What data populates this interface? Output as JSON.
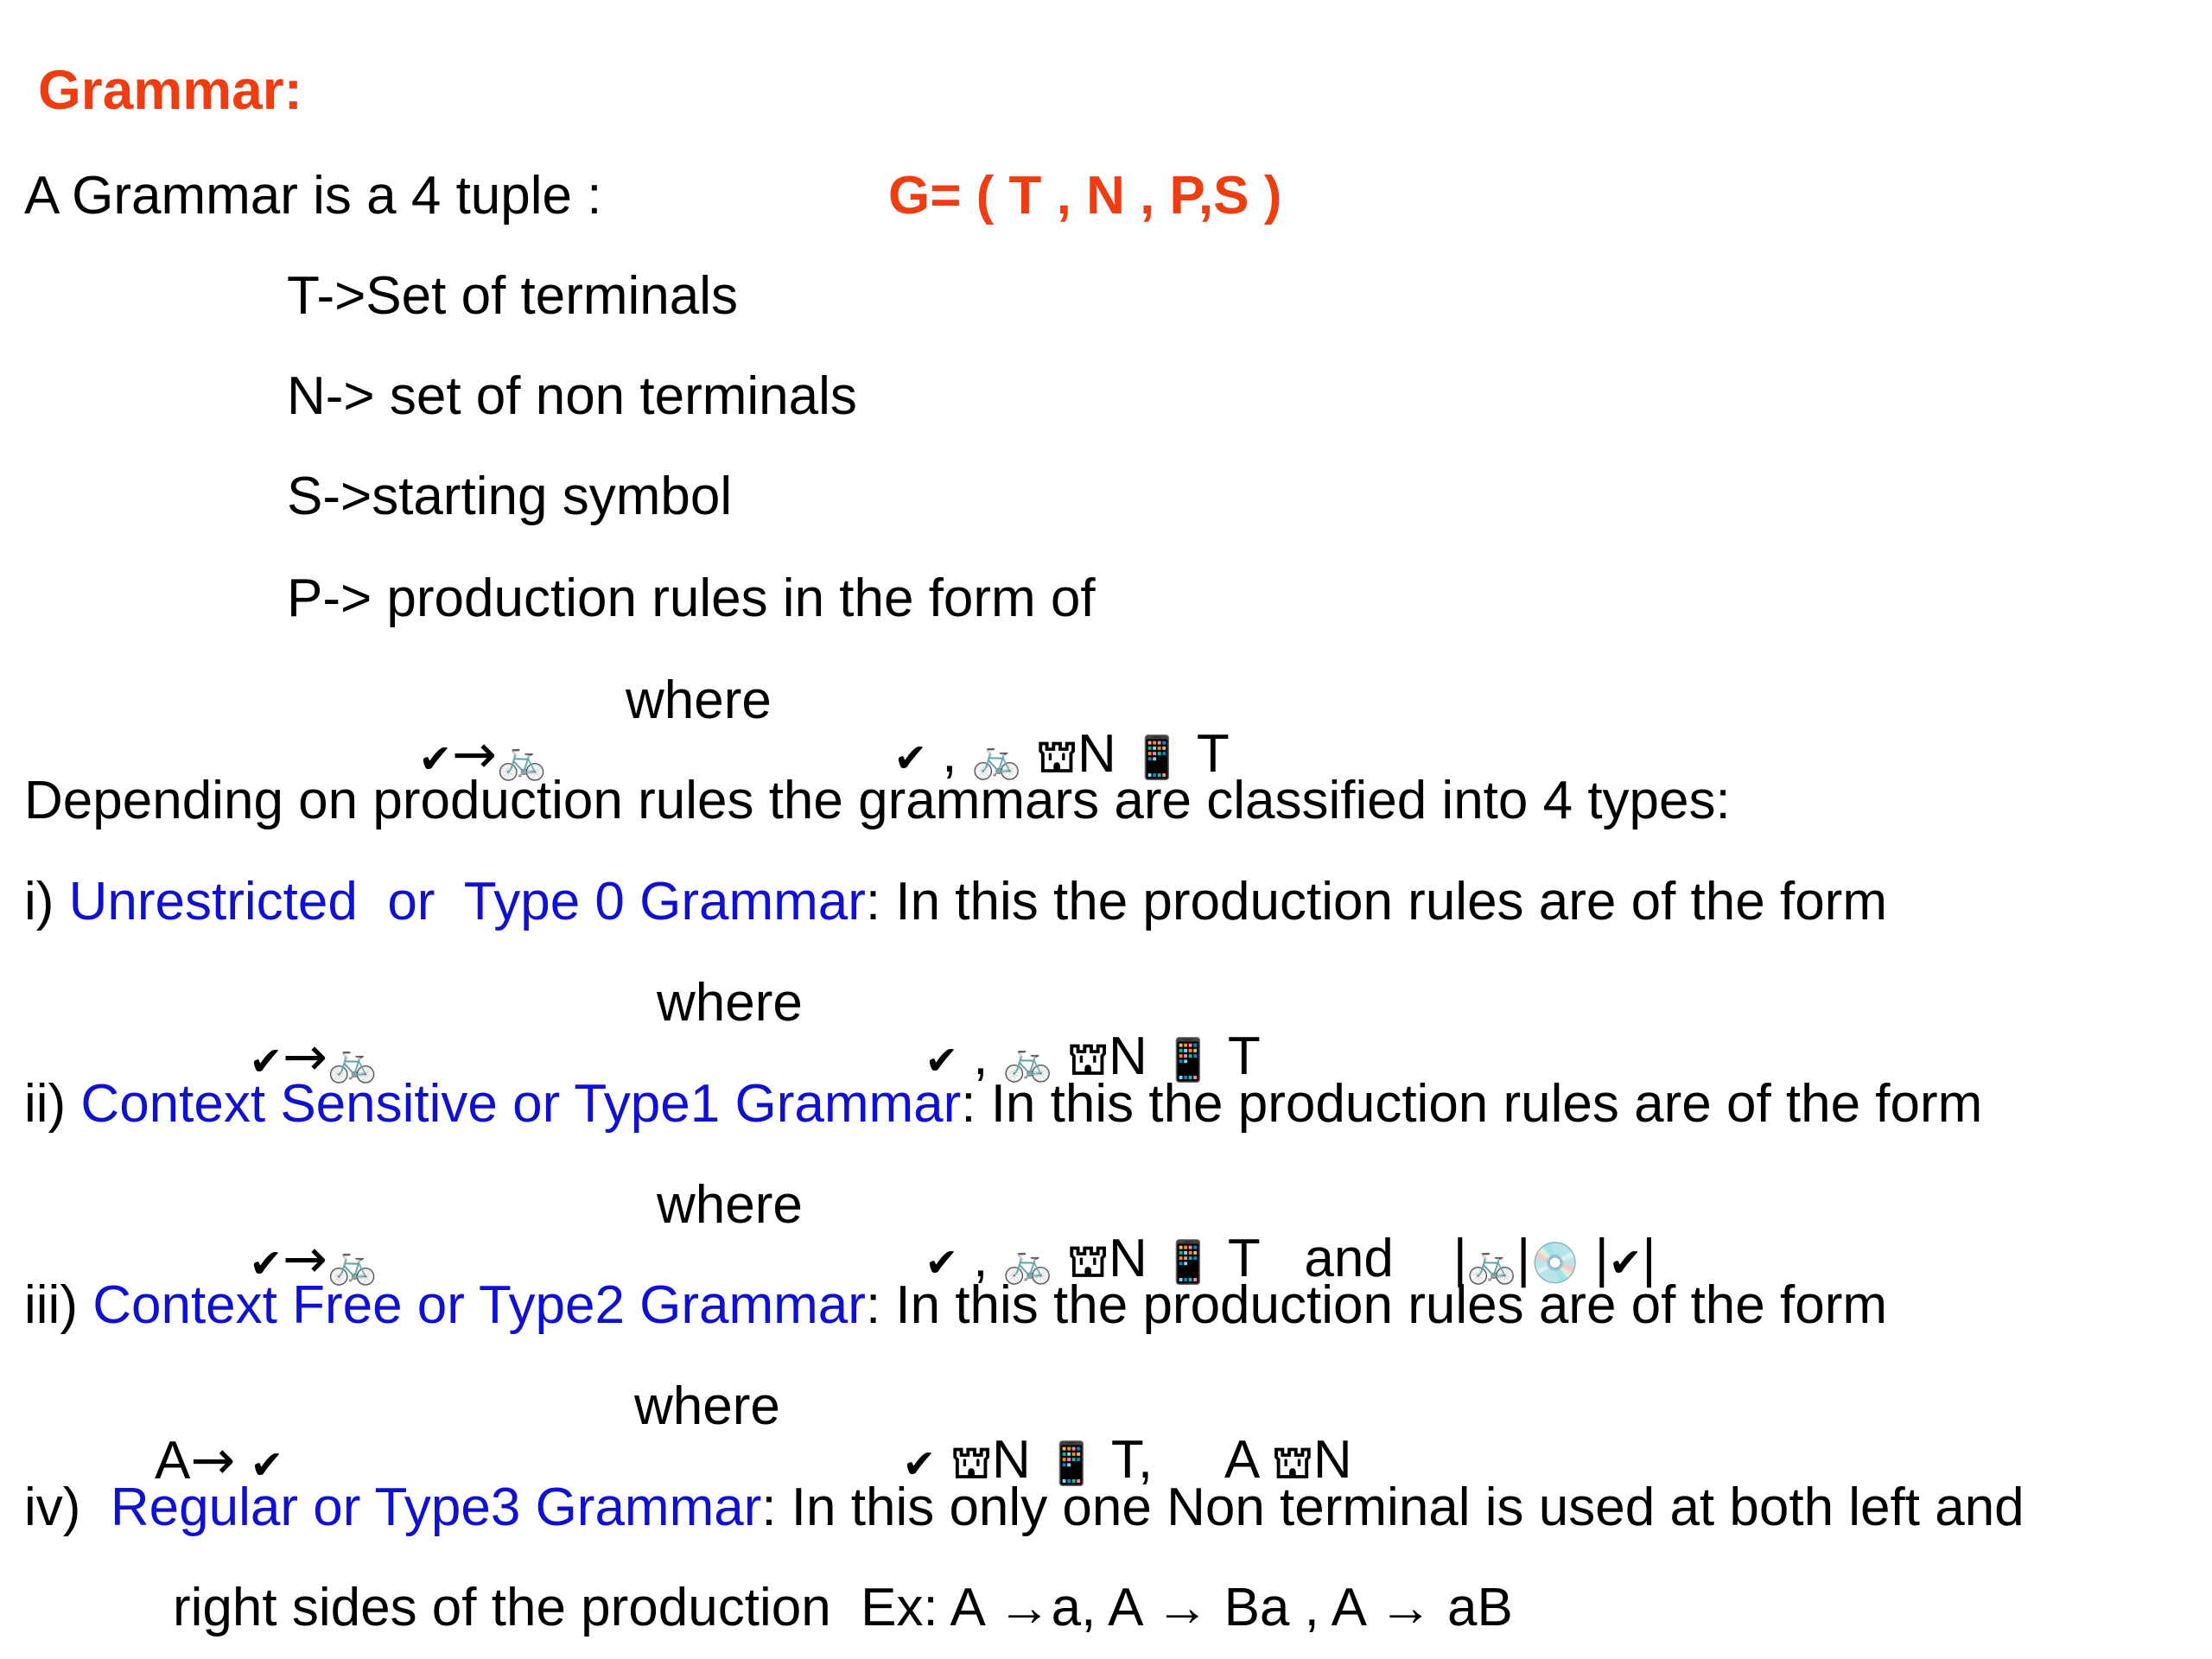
{
  "title": "Grammar:",
  "intro": {
    "text": "A Grammar is a 4 tuple :",
    "formula": "G= ( T , N , P,S )"
  },
  "definitions": [
    "T->Set of terminals",
    "N-> set of non terminals",
    "S->starting symbol",
    "P-> production rules in the form of"
  ],
  "glyphs": {
    "alpha": "✔",
    "beta": "🚲",
    "arrow": "→",
    "element_of": "⛫",
    "union": "📱",
    "gamma": "💿"
  },
  "form_where": "where",
  "comma": ",",
  "sym_N": "N",
  "sym_T": "T",
  "sym_A": "A",
  "and": "and",
  "pipe": "|",
  "t_comma": "T,",
  "classify": "Depending on production rules the grammars are classified into 4 types:",
  "types": [
    {
      "prefix": "i) ",
      "name": "Unrestricted  or  Type 0 Grammar",
      "suffix": ": In this the production rules are of the form"
    },
    {
      "prefix": "ii) ",
      "name": "Context Sensitive or Type1 Grammar",
      "suffix": ": In this the production rules are of the form"
    },
    {
      "prefix": "iii) ",
      "name": "Context Free or Type2 Grammar",
      "suffix": ": In this the production rules are of the form"
    },
    {
      "prefix": "iv)  ",
      "name": "Regular or Type3 Grammar",
      "suffix": ": In this only one Non terminal is used at both left and"
    }
  ],
  "regular_cont": "right sides of the production  Ex: A →a, A → Ba , A → aB",
  "colors": {
    "title": "#ee3d10",
    "type_name": "#1010d0",
    "text": "#000000"
  }
}
